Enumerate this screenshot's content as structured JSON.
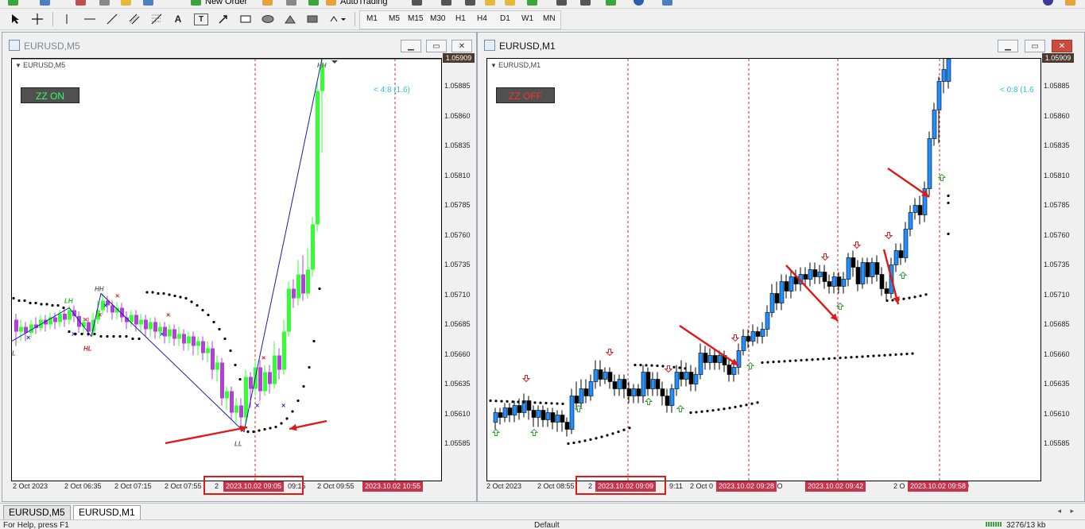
{
  "toolbar": {
    "new_order_label": "New Order",
    "autotrading_label": "AutoTrading",
    "timeframes": [
      "M1",
      "M5",
      "M15",
      "M30",
      "H1",
      "H4",
      "D1",
      "W1",
      "MN"
    ],
    "draw_tool_letters": {
      "text": "A",
      "text_box": "T"
    }
  },
  "colors": {
    "bull_m5": "#33ff33",
    "bear_m5": "#b040d8",
    "bull_m1": "#1e90ff",
    "bear_m1": "#000000",
    "zigzag": "#1a1aa8",
    "vline": "#e02020",
    "arrow_red": "#e01818",
    "axis_marker": "#c8334c",
    "counter": "#26c6da",
    "price_box": "#4d3a2e"
  },
  "windows": [
    {
      "title": "EURUSD,M5",
      "symbol_label": "EURUSD,M5",
      "active": false,
      "zz_button": {
        "label": "ZZ ON",
        "color": "#33ff66"
      },
      "counter_text": "< 4:8 (1.6)",
      "current_price": "1.05909",
      "price_labels": [
        "1.05885",
        "1.05860",
        "1.05835",
        "1.05810",
        "1.05785",
        "1.05760",
        "1.05735",
        "1.05710",
        "1.05685",
        "1.05660",
        "1.05635",
        "1.05610",
        "1.05585"
      ],
      "time_labels": [
        "2 Oct 2023",
        "2 Oct 06:35",
        "2 Oct 07:15",
        "2 Oct 07:55",
        "2",
        "09:15",
        "2 Oct 09:55"
      ],
      "time_markers": [
        "2023.10.02 09:05",
        "2023.10.02 10:55"
      ],
      "framed_marker": "2023.10.02 09:05",
      "swing_labels": {
        "hh_top": "HH",
        "lh": "LH",
        "hh": "HH",
        "hl": "HL",
        "l": "L",
        "ll": "LL"
      }
    },
    {
      "title": "EURUSD,M1",
      "symbol_label": "EURUSD,M1",
      "active": true,
      "zz_button": {
        "label": "ZZ OFF",
        "color": "#ff3030"
      },
      "counter_text": "< 0:8 (1.6",
      "current_price": "1.05909",
      "price_labels": [
        "1.05885",
        "1.05860",
        "1.05835",
        "1.05810",
        "1.05785",
        "1.05760",
        "1.05735",
        "1.05710",
        "1.05685",
        "1.05660",
        "1.05635",
        "1.05610",
        "1.05585"
      ],
      "time_labels": [
        "2 Oct 2023",
        "2 Oct 08:55",
        "2",
        "9:11",
        "2 Oct 0",
        "2 O",
        "9:43",
        "2 O",
        "59"
      ],
      "time_markers": [
        "2023.10.02 09:09",
        "2023.10.02 09:28",
        "2023.10.02 09:42",
        "2023.10.02 09:58"
      ],
      "framed_marker": "2023.10.02 09:09"
    }
  ],
  "tabs": [
    {
      "label": "EURUSD,M5",
      "active": false
    },
    {
      "label": "EURUSD,M1",
      "active": true
    }
  ],
  "status": {
    "left": "For Help, press F1",
    "middle": "Default",
    "right": "3276/13 kb"
  }
}
